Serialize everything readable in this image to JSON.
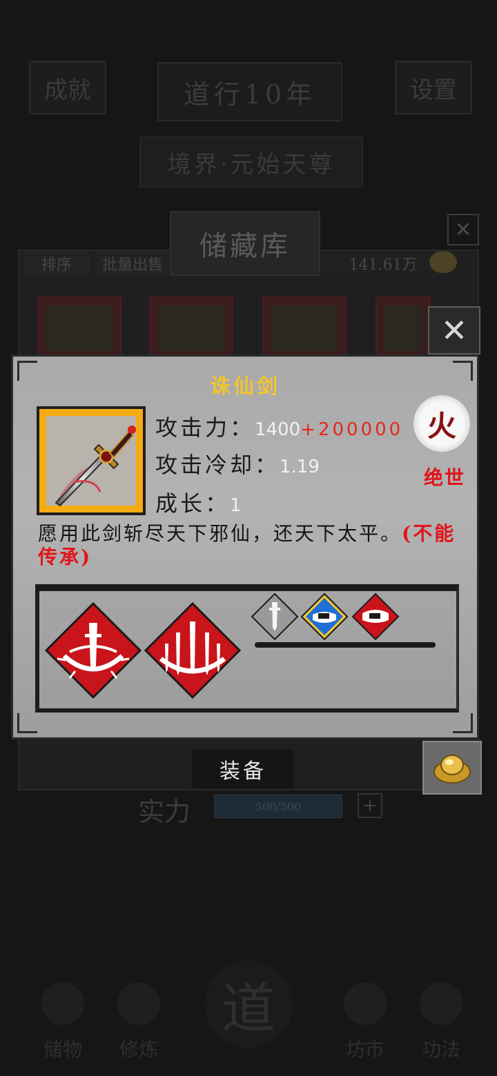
{
  "background": {
    "header_left": "成就",
    "year": "道行10年",
    "header_right": "设置",
    "realm": "境界·元始天尊",
    "storage_title": "储藏库",
    "sort_label": "排序",
    "batch_sell_label": "批量出售",
    "money": "141.61万",
    "strength_label": "实力",
    "strength_value": "500/500",
    "nav": [
      {
        "label": "储物"
      },
      {
        "label": "修炼"
      },
      {
        "label": "道"
      },
      {
        "label": "坊市"
      },
      {
        "label": "功法"
      }
    ]
  },
  "item": {
    "name": "诛仙剑",
    "attack_label": "攻击力：",
    "attack_value": "1400",
    "attack_bonus": "+200000",
    "cooldown_label": "攻击冷却：",
    "cooldown_value": "1.19",
    "growth_label": "成长：",
    "growth_value": "1",
    "element": "火",
    "rarity": "绝世",
    "description": "愿用此剑斩尽天下邪仙，还天下太平。",
    "restriction": "(不能传承)",
    "equip_label": "装备",
    "skills_big": [
      "single-sword-ring-skill-icon",
      "multi-sword-ring-skill-icon"
    ],
    "skills_small": [
      "white-sword-diamond-icon",
      "blue-wave-diamond-icon",
      "red-mask-diamond-icon"
    ]
  },
  "colors": {
    "rarity": "#e0141a",
    "item_name": "#f2c531",
    "frame_orange": "#f4ab12",
    "skill_red": "#c8141a"
  }
}
